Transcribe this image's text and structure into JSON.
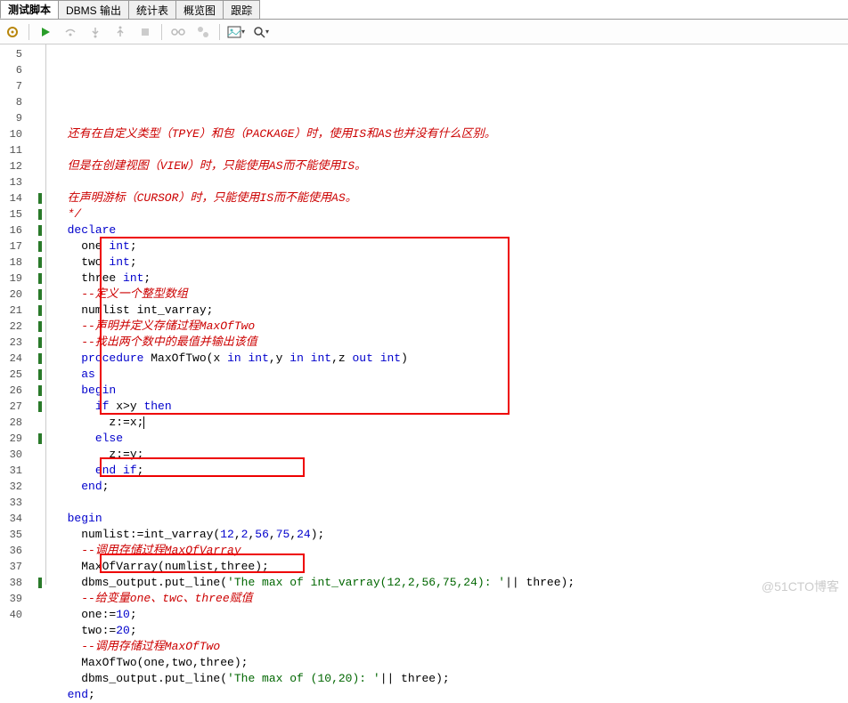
{
  "tabs": [
    "测试脚本",
    "DBMS 输出",
    "统计表",
    "概览图",
    "跟踪"
  ],
  "activeTab": 0,
  "lineStart": 5,
  "lineEnd": 40,
  "markedLines": [
    14,
    15,
    16,
    17,
    18,
    19,
    20,
    21,
    22,
    23,
    24,
    25,
    26,
    27,
    29,
    38
  ],
  "code": {
    "5": {
      "segs": [
        {
          "t": "  还有在自定义类型（TPYE）和包（PACKAGE）时，使用IS和AS也并没有什么区别。",
          "c": "c-red"
        }
      ]
    },
    "6": {
      "segs": [
        {
          "t": "",
          "c": ""
        }
      ]
    },
    "7": {
      "segs": [
        {
          "t": "  但是在创建视图（VIEW）时，只能使用AS而不能使用IS。",
          "c": "c-red"
        }
      ]
    },
    "8": {
      "segs": [
        {
          "t": "",
          "c": ""
        }
      ]
    },
    "9": {
      "segs": [
        {
          "t": "  在声明游标（CURSOR）时，只能使用IS而不能使用AS。",
          "c": "c-red"
        }
      ]
    },
    "10": {
      "segs": [
        {
          "t": "  */",
          "c": "c-red"
        }
      ]
    },
    "11": {
      "segs": [
        {
          "t": "  ",
          "c": ""
        },
        {
          "t": "declare",
          "c": "c-kw"
        }
      ]
    },
    "12": {
      "segs": [
        {
          "t": "    one ",
          "c": ""
        },
        {
          "t": "int",
          "c": "c-kw"
        },
        {
          "t": ";",
          "c": ""
        }
      ]
    },
    "13": {
      "segs": [
        {
          "t": "    two ",
          "c": ""
        },
        {
          "t": "int",
          "c": "c-kw"
        },
        {
          "t": ";",
          "c": ""
        }
      ]
    },
    "14": {
      "segs": [
        {
          "t": "    three ",
          "c": ""
        },
        {
          "t": "int",
          "c": "c-kw"
        },
        {
          "t": ";",
          "c": ""
        }
      ]
    },
    "15": {
      "segs": [
        {
          "t": "    --定义一个整型数组",
          "c": "c-red"
        }
      ]
    },
    "16": {
      "segs": [
        {
          "t": "    numlist int_varray;",
          "c": ""
        }
      ]
    },
    "17": {
      "segs": [
        {
          "t": "    --声明并定义存储过程MaxOfTwo",
          "c": "c-red"
        }
      ]
    },
    "18": {
      "segs": [
        {
          "t": "    --找出两个数中的最值并输出该值",
          "c": "c-red"
        }
      ]
    },
    "19": {
      "segs": [
        {
          "t": "    ",
          "c": ""
        },
        {
          "t": "procedure",
          "c": "c-kw"
        },
        {
          "t": " MaxOfTwo(x ",
          "c": ""
        },
        {
          "t": "in int",
          "c": "c-kw"
        },
        {
          "t": ",y ",
          "c": ""
        },
        {
          "t": "in int",
          "c": "c-kw"
        },
        {
          "t": ",z ",
          "c": ""
        },
        {
          "t": "out int",
          "c": "c-kw"
        },
        {
          "t": ")",
          "c": ""
        }
      ]
    },
    "20": {
      "segs": [
        {
          "t": "    ",
          "c": ""
        },
        {
          "t": "as",
          "c": "c-kw"
        }
      ]
    },
    "21": {
      "segs": [
        {
          "t": "    ",
          "c": ""
        },
        {
          "t": "begin",
          "c": "c-kw"
        }
      ]
    },
    "22": {
      "segs": [
        {
          "t": "      ",
          "c": ""
        },
        {
          "t": "if",
          "c": "c-kw"
        },
        {
          "t": " x>y ",
          "c": ""
        },
        {
          "t": "then",
          "c": "c-kw"
        }
      ]
    },
    "23": {
      "segs": [
        {
          "t": "        z:=x;",
          "c": ""
        }
      ],
      "cursor": true
    },
    "24": {
      "segs": [
        {
          "t": "      ",
          "c": ""
        },
        {
          "t": "else",
          "c": "c-kw"
        }
      ]
    },
    "25": {
      "segs": [
        {
          "t": "        z:=y;",
          "c": ""
        }
      ]
    },
    "26": {
      "segs": [
        {
          "t": "      ",
          "c": ""
        },
        {
          "t": "end if",
          "c": "c-kw"
        },
        {
          "t": ";",
          "c": ""
        }
      ]
    },
    "27": {
      "segs": [
        {
          "t": "    ",
          "c": ""
        },
        {
          "t": "end",
          "c": "c-kw"
        },
        {
          "t": ";",
          "c": ""
        }
      ]
    },
    "28": {
      "segs": [
        {
          "t": "",
          "c": ""
        }
      ]
    },
    "29": {
      "segs": [
        {
          "t": "  ",
          "c": ""
        },
        {
          "t": "begin",
          "c": "c-kw"
        }
      ]
    },
    "30": {
      "segs": [
        {
          "t": "    numlist:=int_varray(",
          "c": ""
        },
        {
          "t": "12",
          "c": "c-blue"
        },
        {
          "t": ",",
          "c": ""
        },
        {
          "t": "2",
          "c": "c-blue"
        },
        {
          "t": ",",
          "c": ""
        },
        {
          "t": "56",
          "c": "c-blue"
        },
        {
          "t": ",",
          "c": ""
        },
        {
          "t": "75",
          "c": "c-blue"
        },
        {
          "t": ",",
          "c": ""
        },
        {
          "t": "24",
          "c": "c-blue"
        },
        {
          "t": ");",
          "c": ""
        }
      ]
    },
    "31": {
      "segs": [
        {
          "t": "    --调用存储过程MaxOfVarray",
          "c": "c-red"
        }
      ]
    },
    "32": {
      "segs": [
        {
          "t": "    MaxOfVarray(numlist,three);",
          "c": ""
        }
      ]
    },
    "33": {
      "segs": [
        {
          "t": "    dbms_output.put_line(",
          "c": ""
        },
        {
          "t": "'The max of int_varray(12,2,56,75,24): '",
          "c": "c-grn"
        },
        {
          "t": "|| three);",
          "c": ""
        }
      ]
    },
    "34": {
      "segs": [
        {
          "t": "    --给变量one、twc、three赋值",
          "c": "c-red"
        }
      ]
    },
    "35": {
      "segs": [
        {
          "t": "    one:=",
          "c": ""
        },
        {
          "t": "10",
          "c": "c-blue"
        },
        {
          "t": ";",
          "c": ""
        }
      ]
    },
    "36": {
      "segs": [
        {
          "t": "    two:=",
          "c": ""
        },
        {
          "t": "20",
          "c": "c-blue"
        },
        {
          "t": ";",
          "c": ""
        }
      ]
    },
    "37": {
      "segs": [
        {
          "t": "    --调用存储过程MaxOfTwo",
          "c": "c-red"
        }
      ]
    },
    "38": {
      "segs": [
        {
          "t": "    MaxOfTwo(one,two,three);",
          "c": ""
        }
      ]
    },
    "39": {
      "segs": [
        {
          "t": "    dbms_output.put_line(",
          "c": ""
        },
        {
          "t": "'The max of (10,20): '",
          "c": "c-grn"
        },
        {
          "t": "|| three);",
          "c": ""
        }
      ]
    },
    "40": {
      "segs": [
        {
          "t": "  ",
          "c": ""
        },
        {
          "t": "end",
          "c": "c-kw"
        },
        {
          "t": ";",
          "c": ""
        }
      ]
    }
  },
  "watermark": "@51CTO博客"
}
